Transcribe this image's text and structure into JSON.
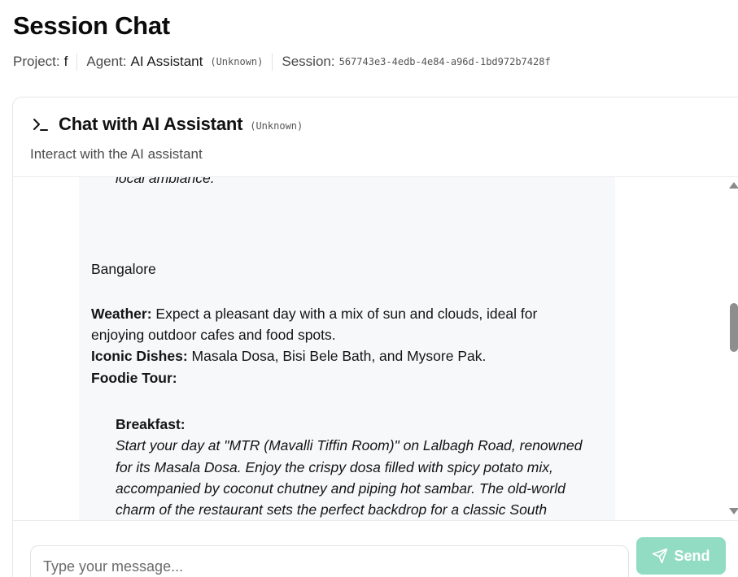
{
  "page": {
    "title": "Session Chat"
  },
  "meta": {
    "project_label": "Project:",
    "project_value": "f",
    "agent_label": "Agent:",
    "agent_value": "AI Assistant",
    "agent_tag": "(Unknown)",
    "session_label": "Session:",
    "session_value": "567743e3-4edb-4e84-a96d-1bd972b7428f"
  },
  "chat": {
    "title": "Chat with AI Assistant",
    "title_tag": "(Unknown)",
    "subtitle": "Interact with the AI assistant"
  },
  "message": {
    "partial_top": "local ambiance.",
    "city": "Bangalore",
    "weather_label": "Weather:",
    "weather_text_1": " Expect a pleasant day with a mix of sun and clouds, ideal for",
    "weather_text_2": "enjoying outdoor cafes and food spots.",
    "dishes_label": "Iconic Dishes:",
    "dishes_text": " Masala Dosa, Bisi Bele Bath, and Mysore Pak.",
    "tour_label": "Foodie Tour:",
    "breakfast_label": "Breakfast:",
    "breakfast_lines": [
      "Start your day at \"MTR (Mavalli Tiffin Room)\" on Lalbagh Road, renowned",
      "for its Masala Dosa. Enjoy the crispy dosa filled with spicy potato mix,",
      "accompanied by coconut chutney and piping hot sambar. The old-world",
      "charm of the restaurant sets the perfect backdrop for a classic South"
    ]
  },
  "composer": {
    "placeholder": "Type your message...",
    "value": "",
    "send_label": "Send"
  },
  "icons": {
    "terminal": "terminal-icon",
    "send": "send-icon",
    "scroll_up": "chevron-up-icon",
    "scroll_down": "chevron-down-icon"
  },
  "colors": {
    "send_button": "#93dcc4",
    "bubble_bg": "#f7f8fa",
    "border": "#e6e6e6"
  }
}
